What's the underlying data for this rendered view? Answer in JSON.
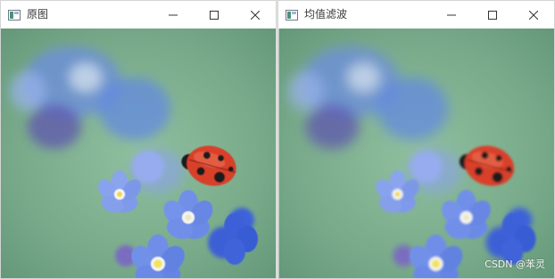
{
  "windows": [
    {
      "title": "原图",
      "controls": {
        "minimize": "minimize-icon",
        "maximize": "maximize-icon",
        "close": "close-icon"
      },
      "image": {
        "subject": "ladybug on blue forget-me-not flowers",
        "blurred": false
      }
    },
    {
      "title": "均值滤波",
      "controls": {
        "minimize": "minimize-icon",
        "maximize": "maximize-icon",
        "close": "close-icon"
      },
      "image": {
        "subject": "ladybug on blue forget-me-not flowers",
        "blurred": true
      }
    }
  ],
  "watermark": "CSDN @苯灵",
  "colors": {
    "background_green": "#7fb08f",
    "petal_blue": "#6f8fe8",
    "petal_deep_blue": "#3f63d9",
    "flower_center": "#f2e35a",
    "ladybug_red": "#d9402a",
    "ladybug_spots": "#1a1a1a",
    "titlebar": "#ffffff"
  }
}
